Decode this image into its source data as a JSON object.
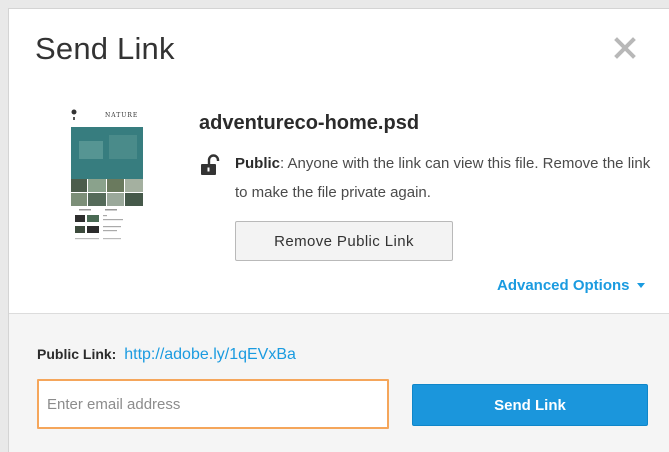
{
  "dialog": {
    "title": "Send Link",
    "close_icon": "close-icon"
  },
  "file": {
    "name": "adventureco-home.psd",
    "thumbnail_title": "NATURE"
  },
  "access": {
    "icon": "unlock-icon",
    "label": "Public",
    "separator": ":",
    "description": " Anyone with the link can view this file. Remove the link to make the file private again."
  },
  "actions": {
    "remove_public_link_label": "Remove Public Link",
    "advanced_options_label": "Advanced Options",
    "advanced_options_icon": "caret-down-icon"
  },
  "share": {
    "public_link_label": "Public Link:",
    "public_link_url": "http://adobe.ly/1qEVxBa",
    "email_placeholder": "Enter email address",
    "email_value": "",
    "send_button_label": "Send Link"
  },
  "colors": {
    "accent": "#1a9be0",
    "focus_border": "#f5a65b",
    "send_button": "#1b96dc"
  }
}
